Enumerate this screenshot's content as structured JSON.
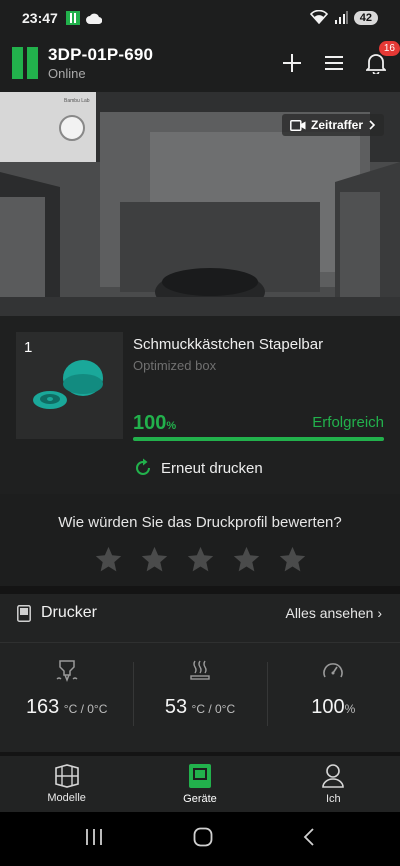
{
  "status_bar": {
    "time": "23:47",
    "battery": "42"
  },
  "header": {
    "device_name": "3DP-01P-690",
    "device_status": "Online",
    "notification_count": "16",
    "accent": "#22b14c"
  },
  "camera": {
    "timelapse_label": "Zeitraffer",
    "printer_brand_text": "Bambu Lab"
  },
  "job": {
    "plate_number": "1",
    "title": "Schmuckkästchen Stapelbar",
    "subtitle": "Optimized box",
    "progress_value": "100",
    "progress_unit": "%",
    "progress_fraction": 1.0,
    "status": "Erfolgreich",
    "reprint_label": "Erneut drucken"
  },
  "rating": {
    "question": "Wie würden Sie das Druckprofil bewerten?",
    "stars_total": 5,
    "stars_filled": 0
  },
  "printer": {
    "title": "Drucker",
    "see_all": "Alles ansehen",
    "stats": [
      {
        "icon": "nozzle-temperature-icon",
        "value": "163",
        "unit": "°C / 0°C"
      },
      {
        "icon": "bed-temperature-icon",
        "value": "53",
        "unit": "°C / 0°C"
      },
      {
        "icon": "speed-gauge-icon",
        "value": "100",
        "unit": "%"
      }
    ]
  },
  "bottom_nav": [
    {
      "label": "Modelle",
      "icon": "models-icon",
      "active": false
    },
    {
      "label": "Geräte",
      "icon": "devices-icon",
      "active": true
    },
    {
      "label": "Ich",
      "icon": "profile-icon",
      "active": false
    }
  ]
}
